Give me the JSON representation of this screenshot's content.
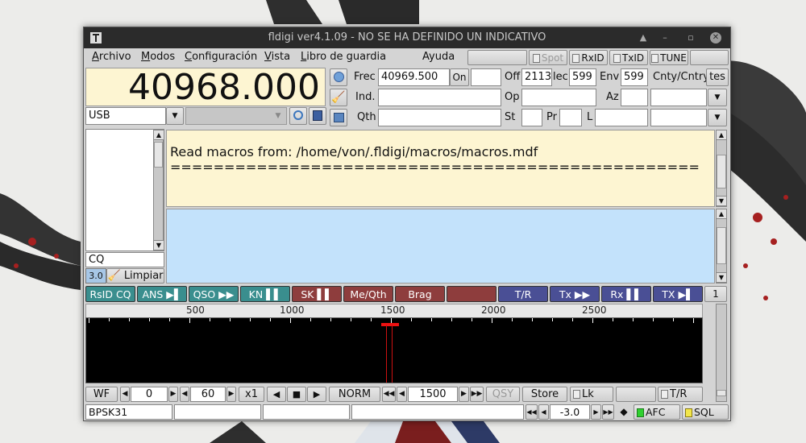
{
  "window": {
    "title": "fldigi ver4.1.09 - NO SE HA DEFINIDO UN INDICATIVO",
    "min": "▲",
    "dash": "–",
    "restore": "▫",
    "close": "✕"
  },
  "menu": {
    "archivo": {
      "first": "A",
      "rest": "rchivo"
    },
    "modos": {
      "first": "M",
      "rest": "odos"
    },
    "config": {
      "first": "C",
      "rest": "onfiguración"
    },
    "vista": {
      "first": "V",
      "rest": "ista"
    },
    "libro": {
      "first": "L",
      "rest": "ibro de guardia"
    },
    "ayuda": "Ayuda"
  },
  "topbuttons": {
    "spot": "Spot",
    "rxid": "RxID",
    "txid": "TxID",
    "tune": "TUNE"
  },
  "freq_display": "40968.000",
  "mode_select": "USB",
  "log": {
    "frec_label": "Frec",
    "frec_value": "40969.500",
    "on_label": "On",
    "off_label": "Off",
    "off_value": "2113",
    "rec_label": "lec",
    "rec_value": "599",
    "env_label": "Env",
    "env_value": "599",
    "cnty_label": "Cnty/Cntry",
    "tes_label": "tes",
    "ind_label": "Ind.",
    "op_label": "Op",
    "az_label": "Az",
    "qth_label": "Qth",
    "st_label": "St",
    "pr_label": "Pr",
    "l_label": "L"
  },
  "rx_text": {
    "line1": "Read macros from: /home/von/.fldigi/macros/macros.mdf",
    "line2": "================================================="
  },
  "sidebar": {
    "cq": "CQ",
    "level": "3.0",
    "clear": "Limpiar"
  },
  "macros": [
    {
      "label": "RsID CQ",
      "color": "teal"
    },
    {
      "label": "ANS ▶▌",
      "color": "teal"
    },
    {
      "label": "QSO ▶▶",
      "color": "teal"
    },
    {
      "label": "KN ▌▌",
      "color": "teal"
    },
    {
      "label": "SK ▌▌",
      "color": "red"
    },
    {
      "label": "Me/Qth",
      "color": "red"
    },
    {
      "label": "Brag",
      "color": "red"
    },
    {
      "label": "",
      "color": "red"
    },
    {
      "label": "T/R",
      "color": "blue"
    },
    {
      "label": "Tx ▶▶",
      "color": "blue"
    },
    {
      "label": "Rx ▌▌",
      "color": "blue"
    },
    {
      "label": "TX ▶▌",
      "color": "blue"
    }
  ],
  "macro_page": "1",
  "waterfall": {
    "ticks": [
      "500",
      "1000",
      "1500",
      "2000",
      "2500"
    ]
  },
  "wfbar": {
    "wf": "WF",
    "left_val": "0",
    "range_val": "60",
    "x1": "x1",
    "norm": "NORM",
    "freq": "1500",
    "qsy": "QSY",
    "store": "Store",
    "lk": "Lk",
    "tr": "T/R"
  },
  "statusbar": {
    "mode": "BPSK31",
    "snr": "-3.0",
    "afc": "AFC",
    "sql": "SQL"
  }
}
